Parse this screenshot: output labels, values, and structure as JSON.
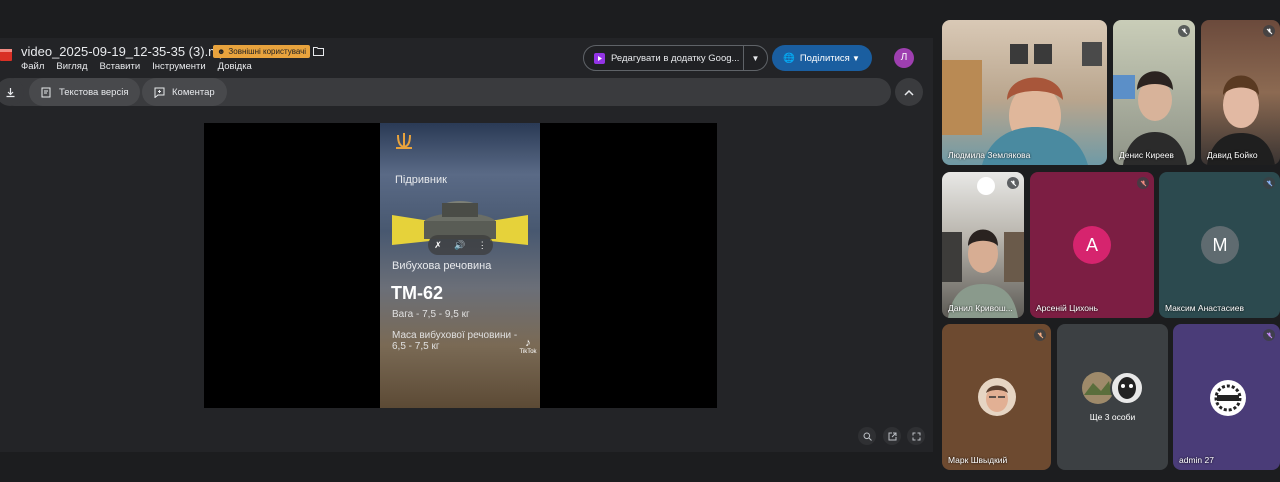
{
  "viewer": {
    "file_title": "video_2025-09-19_12-35-35 (3).mp4",
    "external_badge": "Зовнішні користувачі",
    "menu": [
      "Файл",
      "Вигляд",
      "Вставити",
      "Інструменти",
      "Довідка"
    ],
    "edit_button": "Редагувати в додатку Goog...",
    "share_button": "Поділитися",
    "avatar_letter": "Л",
    "toolbar": {
      "text_version": "Текстова версія",
      "comment": "Коментар"
    }
  },
  "video": {
    "label_detonator": "Підривник",
    "label_explosive": "Вибухова речовина",
    "title": "ТМ-62",
    "weight": "Вага - 7,5 - 9,5 кг",
    "explosive_mass": "Маса вибухової речовини - 6,5 - 7,5 кг",
    "tiktok": "TikTok"
  },
  "participants": [
    {
      "name": "Людмила Землякова"
    },
    {
      "name": "Денис Киреев"
    },
    {
      "name": "Давид Бойко"
    },
    {
      "name": "Данил Кривош..."
    },
    {
      "name": "Арсеній Цихонь",
      "letter": "А",
      "color": "#d6246e"
    },
    {
      "name": "Максим Анастасиев",
      "letter": "М",
      "color": "#5f6b70"
    },
    {
      "name": "Марк Швыдкий"
    },
    {
      "name": "Ще 3 особи"
    },
    {
      "name": "admin 27"
    }
  ],
  "colors": {
    "accent_blue": "#1a5ea0",
    "badge_orange": "#e8a33d",
    "avatar_purple": "#9e3fb0"
  }
}
